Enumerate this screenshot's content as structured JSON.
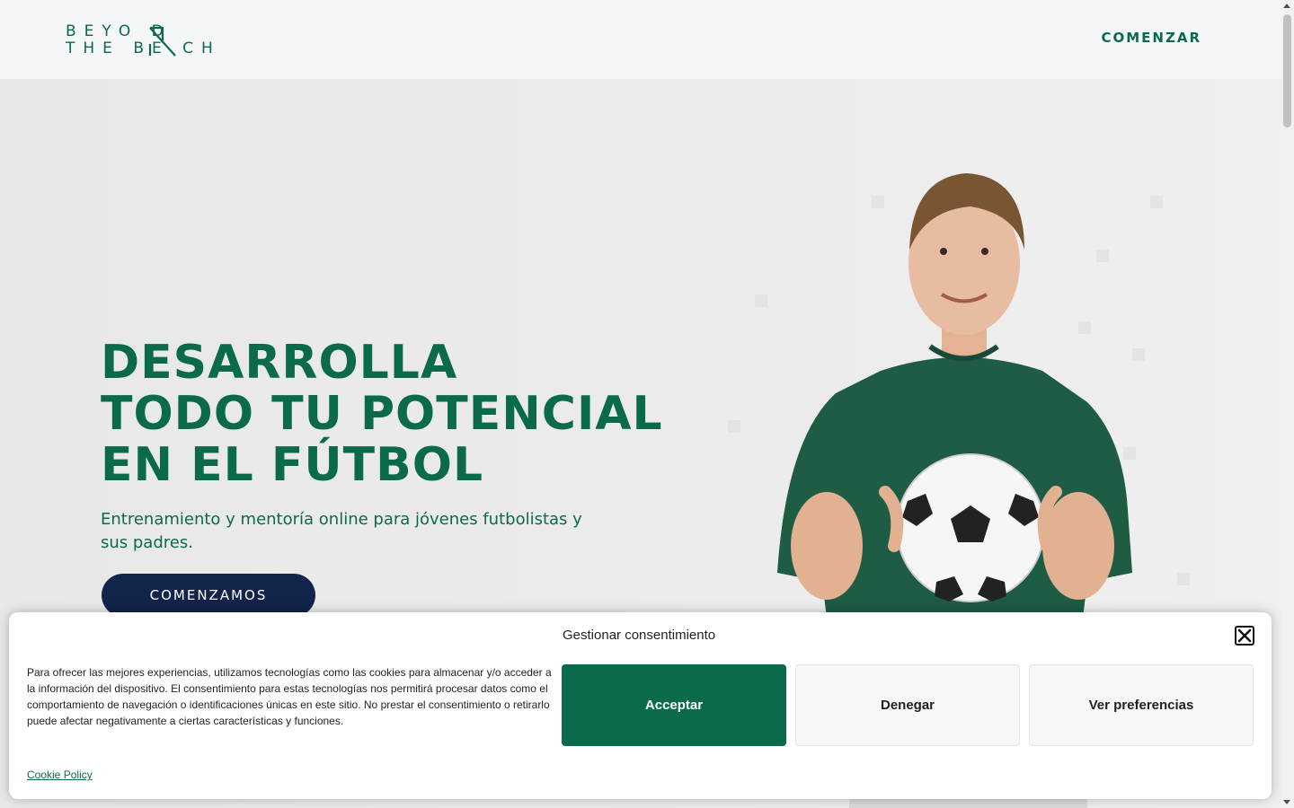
{
  "header": {
    "logo_line1": "BEYO  D",
    "logo_line2": "THE BE  CH",
    "cta_label": "COMENZAR"
  },
  "hero": {
    "title_lines": [
      "DESARROLLA",
      "TODO TU POTENCIAL",
      "EN EL FÚTBOL"
    ],
    "subtitle": "Entrenamiento y mentoría online para jóvenes futbolistas y sus padres.",
    "button_label": "COMENZAMOS"
  },
  "cookie_banner": {
    "title": "Gestionar consentimiento",
    "text": "Para ofrecer las mejores experiencias, utilizamos tecnologías como las cookies para almacenar y/o acceder a la información del dispositivo. El consentimiento para estas tecnologías nos permitirá procesar datos como el comportamiento de navegación o identificaciones únicas en este sitio. No prestar el consentimiento o retirarlo puede afectar negativamente a ciertas características y funciones.",
    "accept_label": "Acceptar",
    "deny_label": "Denegar",
    "preferences_label": "Ver preferencias",
    "policy_link": "Cookie Policy"
  },
  "colors": {
    "brand_green": "#0b6a4b",
    "navy_button": "#13244a",
    "header_bg": "#f5f6f7"
  },
  "icons": [
    "close-icon",
    "logo-n-mark",
    "soccer-ball"
  ]
}
